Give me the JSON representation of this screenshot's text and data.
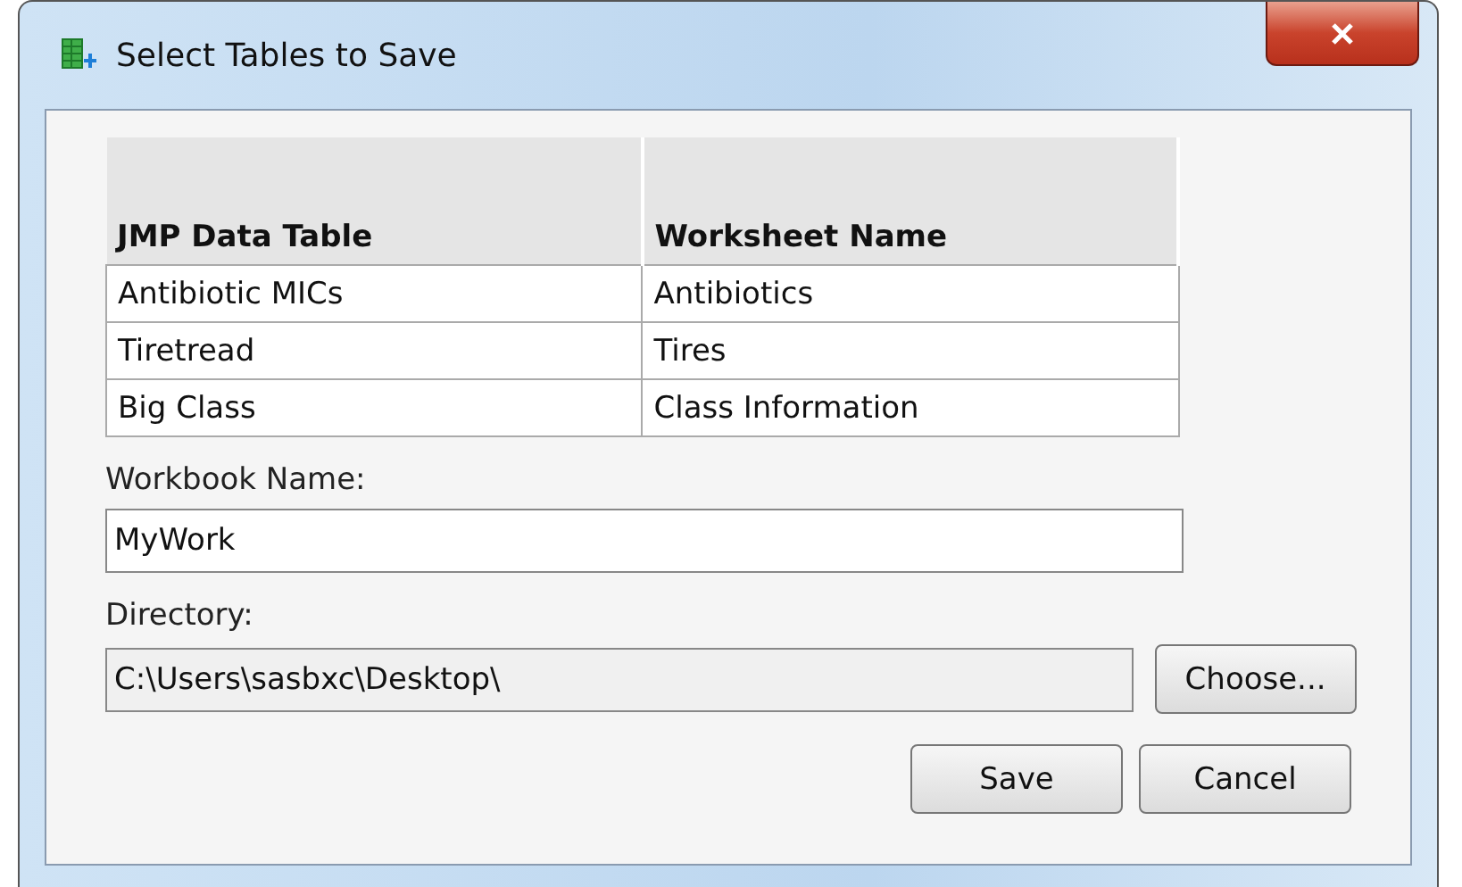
{
  "window": {
    "title": "Select Tables to Save"
  },
  "table": {
    "columns": [
      "JMP Data Table",
      "Worksheet Name"
    ],
    "rows": [
      [
        "Antibiotic MICs",
        "Antibiotics"
      ],
      [
        "Tiretread",
        "Tires"
      ],
      [
        "Big Class",
        "Class Information"
      ]
    ]
  },
  "workbook": {
    "label": "Workbook Name:",
    "value": "MyWork",
    "read_only": false
  },
  "directory": {
    "label": "Directory:",
    "value": "C:\\Users\\sasbxc\\Desktop\\",
    "read_only": true,
    "button": "Choose..."
  },
  "buttons": [
    "Save",
    "Cancel"
  ]
}
